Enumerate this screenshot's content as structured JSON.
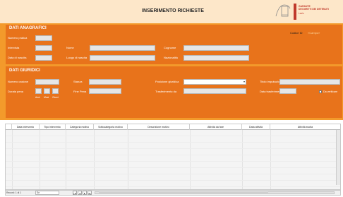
{
  "header": {
    "title": "INSERIMENTO RICHIESTE",
    "logo_lines": [
      "GARANTE",
      "DEI DIRITTI DEI DETENUTI",
      "Lazio"
    ]
  },
  "dati_anagrafici": {
    "title": "DATI ANAGRAFICI",
    "numero_pratica": "Numero pratica",
    "intervista": "Intervista",
    "data_nascita": "Data di nascita",
    "nome": "Nome",
    "luogo_nascita": "Luogo di nascita",
    "cognome": "Cognome",
    "nazionalita": "Nazionalità",
    "codice_id": "Codice ID",
    "codice_id_value": "«Campo»"
  },
  "dati_giuridici": {
    "title": "DATI GIURIDICI",
    "numero_casione": "Numero casione",
    "durata_pena": "Durata pena",
    "durata_units": [
      "Anni",
      "Mesi",
      "Giorni"
    ],
    "stanza": "Stanza",
    "fine_pena": "Fine Pena",
    "posizione_giuridica": "Posizione giuridica",
    "trasferimento_da": "Trasferimento da",
    "titolo_imputazione": "Titolo imputazione",
    "data_trasferimento": "Data trasferimento",
    "da_verificare": "Da verificare"
  },
  "table": {
    "columns": [
      "Data intervento",
      "Tipo intervento",
      "Categoria motivo",
      "Sottocategoria motivo",
      "Descrizione motivo",
      "Attività da fare",
      "Data attività",
      "Attività svolta"
    ]
  },
  "statusbar": {
    "record_label": "Record: 1 di 1",
    "search": "Se",
    "nav_buttons": [
      "|◄",
      "◄",
      "►",
      "►|"
    ]
  },
  "colors": {
    "band_orange": "#f39a2b",
    "section_orange": "#e8731b",
    "header_bg": "#fde7c9"
  }
}
